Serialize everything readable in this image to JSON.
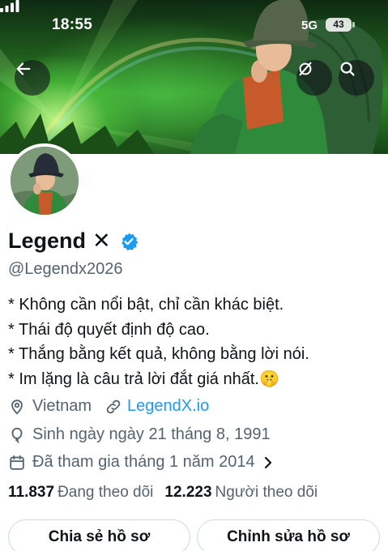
{
  "status_bar": {
    "time": "18:55",
    "network": "5G",
    "battery": "43"
  },
  "profile": {
    "display_name": "Legend",
    "name_badge": "✕",
    "handle": "@Legendx2026",
    "bio": [
      "* Không cần nổi bật, chỉ cần khác biệt.",
      "* Thái độ quyết định độ cao.",
      "* Thắng bằng kết quả, không bằng lời nói.",
      "* Im lặng là câu trả lời đắt giá nhất.🤫"
    ],
    "location": "Vietnam",
    "website": "LegendX.io",
    "birthday": "Sinh ngày ngày 21 tháng 8, 1991",
    "joined": "Đã tham gia tháng 1 năm 2014",
    "following_count": "11.837",
    "following_label": "Đang theo dõi",
    "followers_count": "12.223",
    "followers_label": "Người theo dõi"
  },
  "actions": {
    "share_label": "Chia sẻ hồ sơ",
    "edit_label": "Chỉnh sửa hồ sơ"
  },
  "colors": {
    "accent": "#1d9bf0",
    "secondary_text": "#536471",
    "verified": "#1d9bf0"
  },
  "icons": [
    "back-arrow-icon",
    "no-spam-icon",
    "search-icon",
    "verified-badge-icon",
    "location-pin-icon",
    "link-icon",
    "balloon-icon",
    "calendar-icon",
    "chevron-right-icon"
  ]
}
